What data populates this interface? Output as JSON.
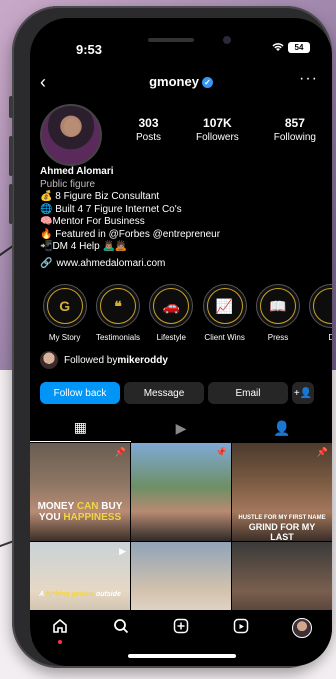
{
  "status": {
    "time": "9:53",
    "battery": "54"
  },
  "header": {
    "username": "gmoney",
    "back_icon": "‹",
    "more_icon": "···"
  },
  "stats": [
    {
      "number": "303",
      "label": "Posts"
    },
    {
      "number": "107K",
      "label": "Followers"
    },
    {
      "number": "857",
      "label": "Following"
    }
  ],
  "bio": {
    "name": "Ahmed Alomari",
    "category": "Public figure",
    "lines": [
      "💰 8 Figure Biz Consultant",
      "🌐 Built 4 7 Figure Internet Co's",
      "🧠Mentor For Business",
      "🔥 Featured in @Forbes @entrepreneur",
      "📲DM 4 Help 🙇🏽‍♂️🙇🏽"
    ],
    "link": "www.ahmedalomari.com"
  },
  "highlights": [
    {
      "label": "My Story",
      "glyph": "G"
    },
    {
      "label": "Testimonials",
      "glyph": "❝"
    },
    {
      "label": "Lifestyle",
      "glyph": "🚗"
    },
    {
      "label": "Client Wins",
      "glyph": "📈"
    },
    {
      "label": "Press",
      "glyph": "📖"
    },
    {
      "label": "D",
      "glyph": ""
    }
  ],
  "followed_by": {
    "prefix": "Followed by ",
    "user": "mikeroddy"
  },
  "buttons": {
    "follow_back": "Follow back",
    "message": "Message",
    "email": "Email",
    "add_person": "+👤"
  },
  "tabs": [
    {
      "name": "grid-icon",
      "glyph": "▦"
    },
    {
      "name": "reels-icon",
      "glyph": "▶"
    },
    {
      "name": "tagged-icon",
      "glyph": "👤"
    }
  ],
  "grid": [
    {
      "caption_a": "MONEY ",
      "caption_b": "CAN",
      "caption_c": " BUY",
      "caption_d": "YOU ",
      "caption_e": "HAPPINESS",
      "pinned": true
    },
    {
      "pinned": true
    },
    {
      "caption_a": "HUSTLE FOR MY FIRST NAME",
      "caption_b": "GRIND FOR MY LAST",
      "pinned": true
    },
    {
      "caption_a": "A ",
      "caption_b": "fu*king genius",
      "caption_c": " outside",
      "reel": true
    },
    {},
    {}
  ],
  "colors": {
    "accent": "#0095f6",
    "verified": "#3897f0",
    "gold": "#d4af37",
    "highlight_yellow": "#f2d544"
  }
}
